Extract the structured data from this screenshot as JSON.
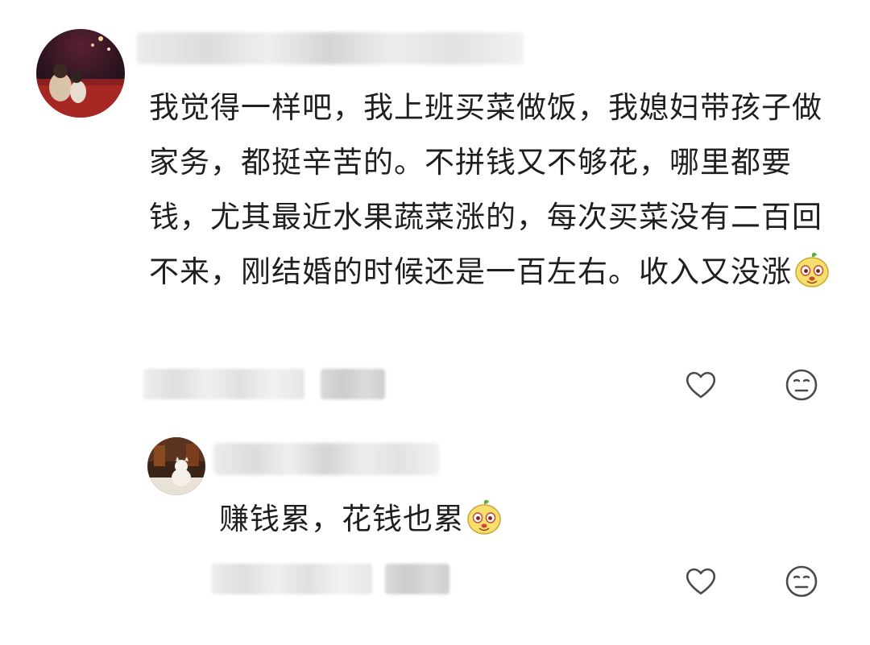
{
  "comments": [
    {
      "author": "",
      "text": "我觉得一样吧，我上班买菜做饭，我媳妇带孩子做家务，都挺辛苦的。不拼钱又不够花，哪里都要钱，尤其最近水果蔬菜涨的，每次买菜没有二百回不来，刚结婚的时候还是一百左右。收入又没涨",
      "emoji": "cute-dog-emoji",
      "actions": [
        "heart-icon",
        "neutral-face-icon"
      ]
    },
    {
      "author": "",
      "text": "赚钱累，花钱也累",
      "emoji": "cute-dog-emoji",
      "actions": [
        "heart-icon",
        "neutral-face-icon"
      ]
    }
  ]
}
